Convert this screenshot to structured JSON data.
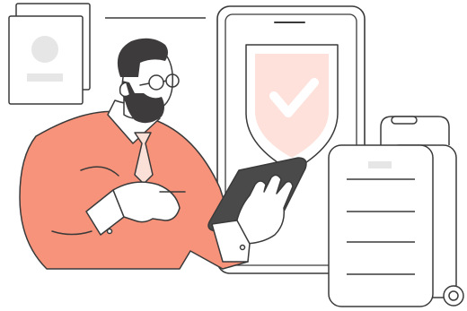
{
  "illustration": {
    "subject": "person-holding-tablet-with-phone-security-shield-and-luggage",
    "icons": {
      "passport": "passport-icon",
      "phone": "smartphone-icon",
      "shield": "shield-check-icon",
      "luggage": "suitcase-icon",
      "tablet": "tablet-icon"
    }
  },
  "colors": {
    "stroke": "#3a3a3a",
    "shirt": "#f7937a",
    "shield_fill": "#fde1da",
    "check": "#ffffff",
    "hair": "#3d3b3c",
    "passport_photo": "#e6e6e6",
    "tablet": "#4a4a4a",
    "background": "#ffffff"
  }
}
